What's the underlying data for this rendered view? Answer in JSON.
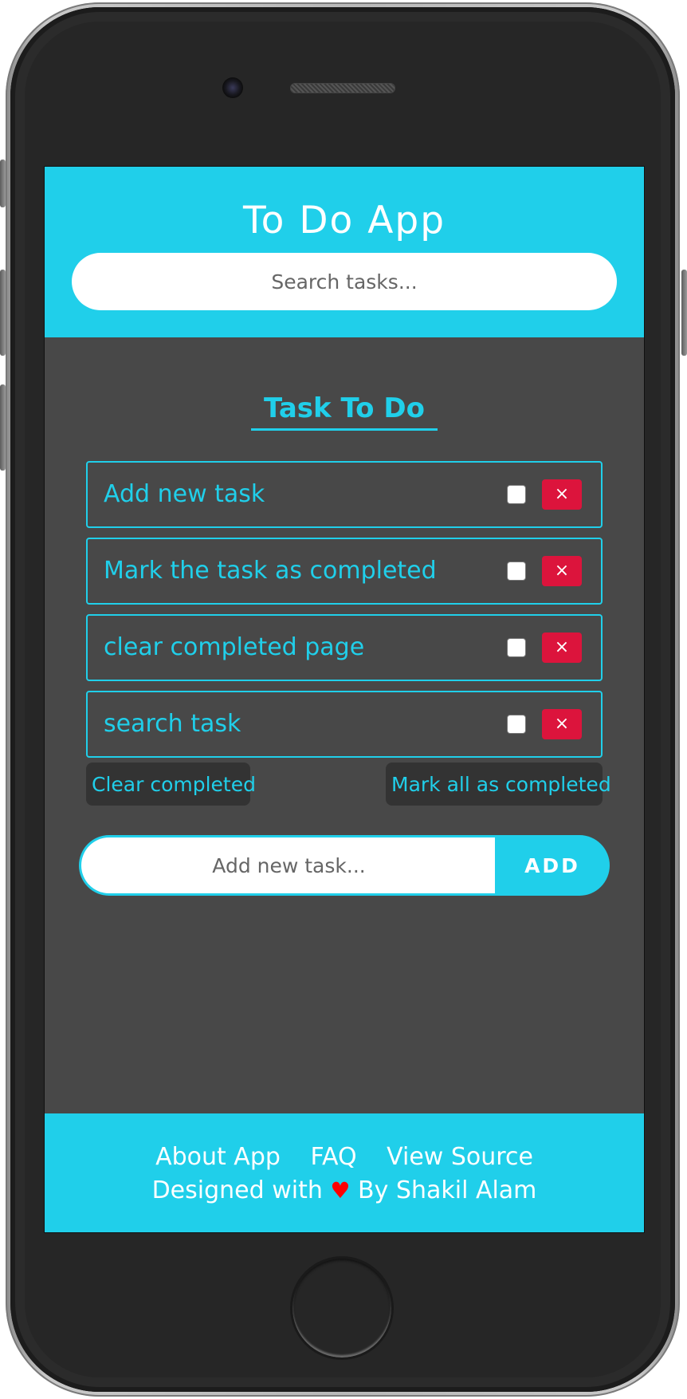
{
  "app": {
    "title": "To Do App",
    "search_placeholder": "Search tasks..."
  },
  "section": {
    "title": "Task To Do"
  },
  "tasks": [
    {
      "text": "Add new task",
      "completed": false,
      "delete_label": "×"
    },
    {
      "text": "Mark the task as completed",
      "completed": false,
      "delete_label": "×"
    },
    {
      "text": "clear completed page",
      "completed": false,
      "delete_label": "×"
    },
    {
      "text": "search task",
      "completed": false,
      "delete_label": "×"
    }
  ],
  "actions": {
    "clear_completed": "Clear completed",
    "mark_all": "Mark all as completed"
  },
  "add_form": {
    "placeholder": "Add new task...",
    "button_label": "ADD"
  },
  "footer": {
    "links": [
      "About App",
      "FAQ",
      "View Source"
    ],
    "credit_prefix": "Designed with",
    "heart": "♥",
    "credit_suffix": "By Shakil Alam"
  },
  "colors": {
    "accent": "#20cfea",
    "background": "#484848",
    "delete": "#dc143c",
    "button_dark": "#333333"
  }
}
